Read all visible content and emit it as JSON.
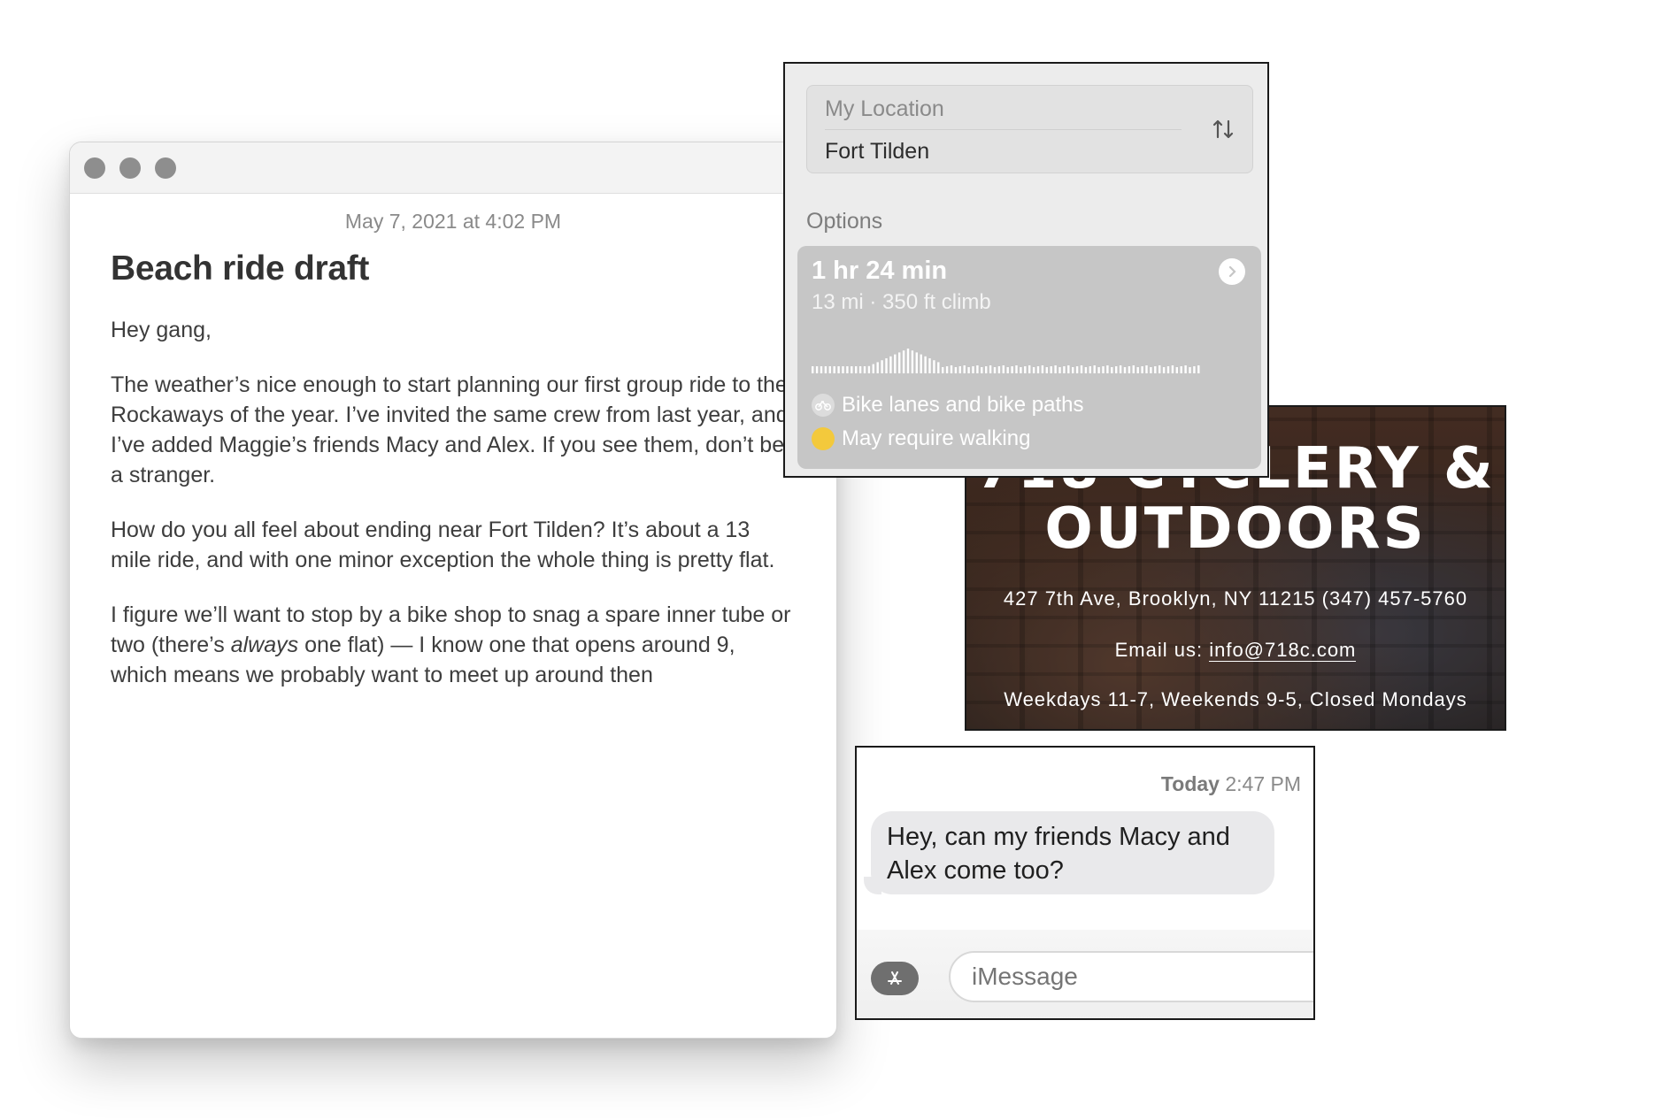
{
  "notes": {
    "date": "May 7, 2021 at 4:02 PM",
    "title": "Beach ride draft",
    "greeting": "Hey gang,",
    "para1": "The weather’s nice enough to start planning our first group ride to the Rockaways of the year. I’ve invited the same crew from last year, and I’ve added Maggie’s friends Macy and Alex. If you see them, don’t be a stranger.",
    "para2": "How do you all feel about ending near Fort Tilden? It’s about a 13 mile ride, and with one minor exception the whole thing is pretty flat.",
    "para3_before": "I figure we’ll want to stop by a bike shop to snag a spare inner tube or two (there’s ",
    "para3_emph": "always",
    "para3_after": " one flat) — I know one that opens around 9, which means we probably want to meet up around then"
  },
  "maps": {
    "from": "My Location",
    "to": "Fort Tilden",
    "options_label": "Options",
    "route": {
      "time": "1 hr 24 min",
      "distance": "13 mi · 350 ft climb",
      "note_bike": "Bike lanes and bike paths",
      "note_walk": "May require walking"
    }
  },
  "shop": {
    "title_line1": "718 CYCLERY &",
    "title_line2": "OUTDOORS",
    "address_phone": "427 7th Ave, Brooklyn, NY 11215 (347) 457-5760",
    "email_label": "Email us: ",
    "email": "info@718c.com",
    "hours": "Weekdays 11-7, Weekends 9-5, Closed Mondays"
  },
  "messages": {
    "time_day": "Today",
    "time_clock": "2:47 PM",
    "bubble_text": "Hey, can my friends Macy and Alex come too?",
    "input_placeholder": "iMessage"
  }
}
